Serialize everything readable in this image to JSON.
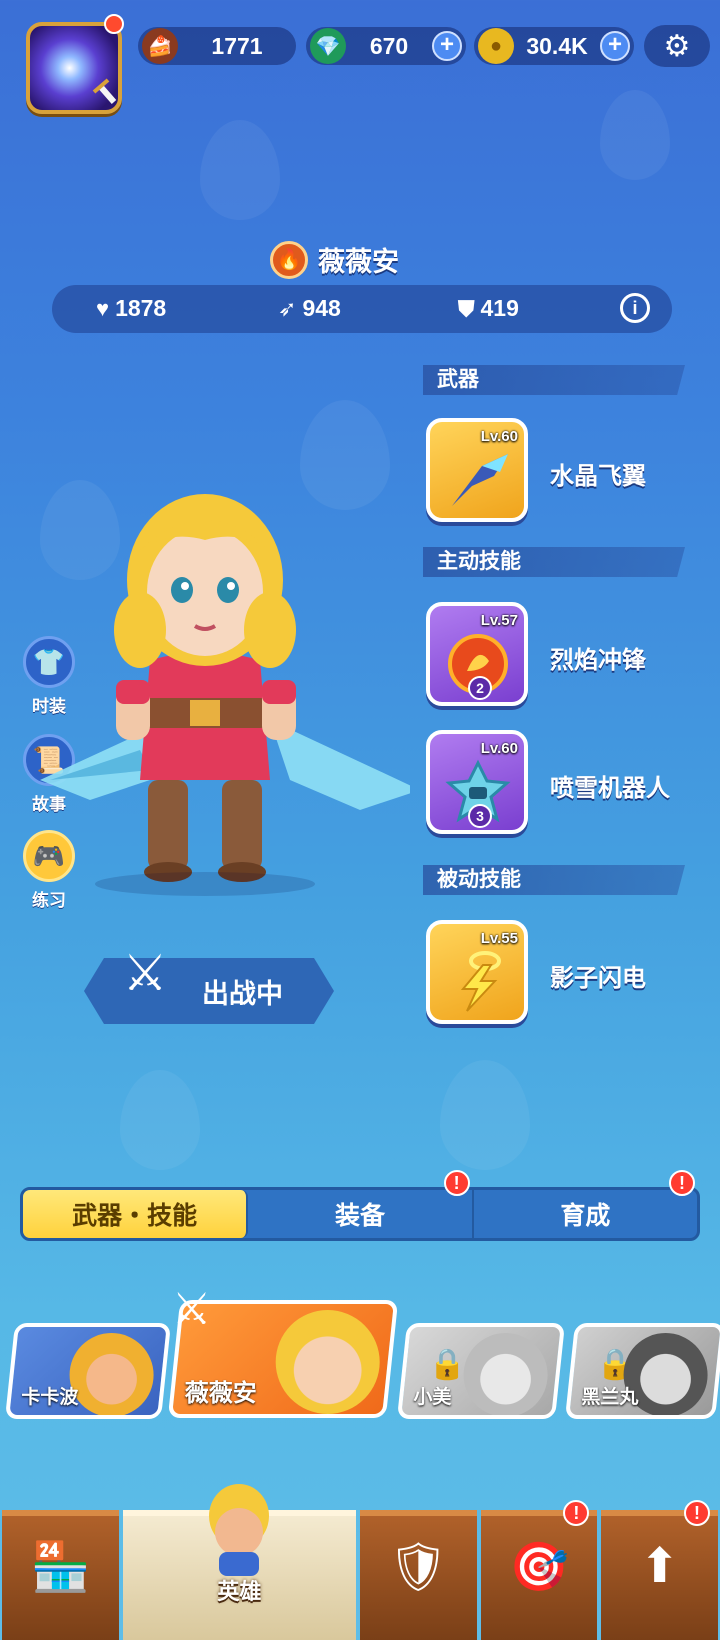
{
  "currencies": {
    "cake": "1771",
    "gems": "670",
    "coins": "30.4K"
  },
  "hero": {
    "name": "薇薇安",
    "hp": "1878",
    "attack": "948",
    "defense": "419"
  },
  "sections": {
    "weapon": "武器",
    "active": "主动技能",
    "passive": "被动技能"
  },
  "skills": [
    {
      "level": "Lv.60",
      "name": "水晶飞翼"
    },
    {
      "level": "Lv.57",
      "name": "烈焰冲锋",
      "count": "2"
    },
    {
      "level": "Lv.60",
      "name": "喷雪机器人",
      "count": "3"
    },
    {
      "level": "Lv.55",
      "name": "影子闪电"
    }
  ],
  "side_buttons": [
    {
      "label": "时装"
    },
    {
      "label": "故事"
    },
    {
      "label": "练习"
    }
  ],
  "deploy_label": "出战中",
  "tabs": [
    {
      "label": "武器・技能"
    },
    {
      "label": "装备"
    },
    {
      "label": "育成"
    }
  ],
  "alert_mark": "!",
  "hero_cards": [
    {
      "name": "卡卡波"
    },
    {
      "name": "薇薇安"
    },
    {
      "name": "小美"
    },
    {
      "name": "黑兰丸"
    }
  ],
  "nav": {
    "heroes_label": "英雄"
  },
  "colors": {
    "accent": "#ffd23c",
    "bg_top": "#3b6fd6",
    "bg_bottom": "#5ebde8"
  }
}
